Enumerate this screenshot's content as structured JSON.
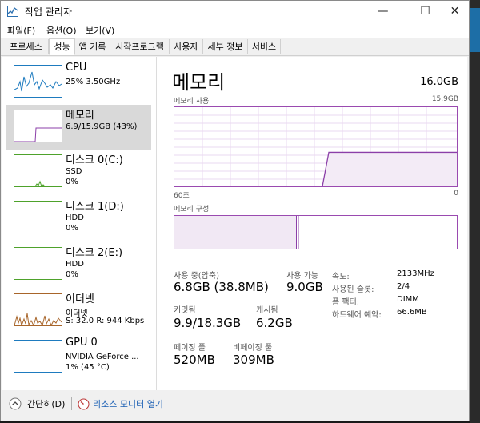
{
  "window": {
    "title": "작업 관리자",
    "minimize": "—",
    "maximize": "☐",
    "close": "✕"
  },
  "menu": [
    "파일(F)",
    "옵션(O)",
    "보기(V)"
  ],
  "tabs": [
    "프로세스",
    "성능",
    "앱 기록",
    "시작프로그램",
    "사용자",
    "세부 정보",
    "서비스"
  ],
  "active_tab": "성능",
  "sidebar": [
    {
      "name": "CPU",
      "sub1": "25%  3.50GHz",
      "sub2": "",
      "color": "#1e7bbf"
    },
    {
      "name": "메모리",
      "sub1": "6.9/15.9GB (43%)",
      "sub2": "",
      "color": "#8b3fa8"
    },
    {
      "name": "디스크 0(C:)",
      "sub1": "SSD",
      "sub2": "0%",
      "color": "#4ea22b"
    },
    {
      "name": "디스크 1(D:)",
      "sub1": "HDD",
      "sub2": "0%",
      "color": "#4ea22b"
    },
    {
      "name": "디스크 2(E:)",
      "sub1": "HDD",
      "sub2": "0%",
      "color": "#4ea22b"
    },
    {
      "name": "이더넷",
      "sub1": "이더넷",
      "sub2": "S:  32.0  R:  944 Kbps",
      "color": "#a8652a"
    },
    {
      "name": "GPU 0",
      "sub1": "NVIDIA GeForce ...",
      "sub2": "1% (45 °C)",
      "color": "#1e7bbf"
    }
  ],
  "main": {
    "title": "메모리",
    "total": "16.0GB",
    "usage_label": "메모리 사용",
    "usage_max": "15.9GB",
    "axis_left": "60초",
    "axis_right": "0",
    "composition_label": "메모리 구성",
    "memory_usage_fraction": 0.43
  },
  "stats": {
    "in_use_label": "사용 중(압축)",
    "in_use_value": "6.8GB (38.8MB)",
    "available_label": "사용 가능",
    "available_value": "9.0GB",
    "committed_label": "커밋됨",
    "committed_value": "9.9/18.3GB",
    "cached_label": "캐시됨",
    "cached_value": "6.2GB",
    "paged_label": "페이징 풀",
    "paged_value": "520MB",
    "nonpaged_label": "비페이징 풀",
    "nonpaged_value": "309MB"
  },
  "info": [
    {
      "label": "속도:",
      "value": "2133MHz"
    },
    {
      "label": "사용된 슬롯:",
      "value": "2/4"
    },
    {
      "label": "폼 팩터:",
      "value": "DIMM"
    },
    {
      "label": "하드웨어 예약:",
      "value": "66.6MB"
    }
  ],
  "footer": {
    "fewer": "간단히(D)",
    "monitor": "리소스 모니터 열기"
  },
  "icons": {
    "collapse": "chevron-up-icon",
    "monitor": "resource-monitor-icon",
    "app": "task-manager-icon"
  }
}
